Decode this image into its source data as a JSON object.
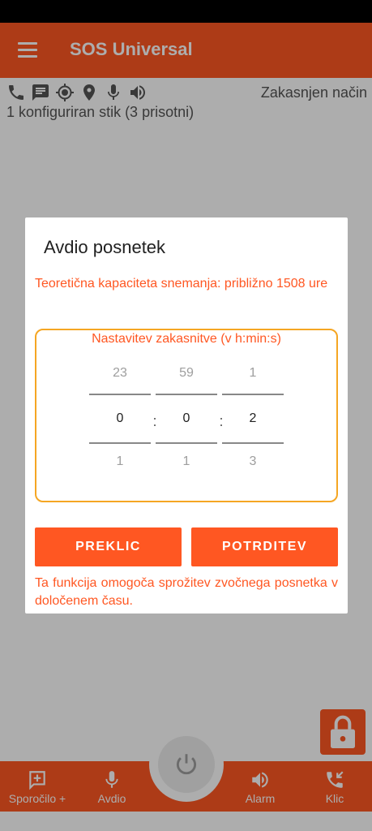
{
  "app": {
    "title": "SOS Universal",
    "menu_icon": "hamburger-menu-icon",
    "accent_color": "#ff5722"
  },
  "status": {
    "icons": [
      "phone-icon",
      "message-icon",
      "gps-icon",
      "location-pin-icon",
      "microphone-icon",
      "volume-icon"
    ],
    "mode": "Zakasnjen način",
    "contacts": "1 konfiguriran stik (3 prisotni)"
  },
  "bottom_nav": {
    "items": [
      {
        "label": "Sporočilo +",
        "icon": "add-message-icon"
      },
      {
        "label": "Avdio",
        "icon": "microphone-icon"
      },
      {
        "label": "Alarm",
        "icon": "volume-icon"
      },
      {
        "label": "Klic",
        "icon": "call-icon"
      }
    ],
    "power_icon": "power-icon",
    "lock_icon": "lock-icon"
  },
  "dialog": {
    "title": "Avdio posnetek",
    "capacity": "Teoretična kapaciteta snemanja: približno 1508 ure",
    "picker": {
      "caption": "Nastavitev zakasnitve (v h:min:s)",
      "hours": {
        "prev": "23",
        "current": "0",
        "next": "1"
      },
      "minutes": {
        "prev": "59",
        "current": "0",
        "next": "1"
      },
      "seconds": {
        "prev": "1",
        "current": "2",
        "next": "3"
      },
      "separator": ":"
    },
    "cancel_label": "PREKLIC",
    "confirm_label": "POTRDITEV",
    "info": "Ta funkcija omogoča sprožitev zvočnega posnetka v določenem času.",
    "border_color": "#f5a623"
  }
}
